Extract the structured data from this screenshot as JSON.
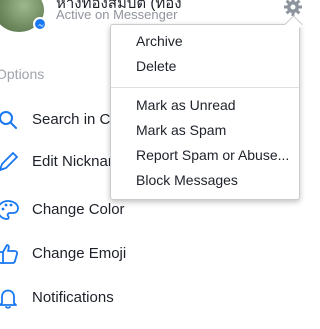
{
  "header": {
    "contact_name": "ห้างทองสมบัติ (ทอง",
    "active_status": "Active on Messenger",
    "settings_icon": "gear-icon"
  },
  "options": {
    "heading": "Options",
    "items": [
      {
        "label": "Search in Conversation",
        "icon": "search-icon"
      },
      {
        "label": "Edit Nicknames",
        "icon": "pencil-icon"
      },
      {
        "label": "Change Color",
        "icon": "palette-icon"
      },
      {
        "label": "Change Emoji",
        "icon": "thumbs-up-icon"
      },
      {
        "label": "Notifications",
        "icon": "bell-icon"
      }
    ]
  },
  "menu": {
    "group1": [
      {
        "label": "Archive"
      },
      {
        "label": "Delete"
      }
    ],
    "group2": [
      {
        "label": "Mark as Unread"
      },
      {
        "label": "Mark as Spam"
      },
      {
        "label": "Report Spam or Abuse..."
      },
      {
        "label": "Block Messages"
      }
    ]
  },
  "colors": {
    "accent": "#1877f2",
    "text": "#1d2129",
    "muted": "#90949c"
  }
}
